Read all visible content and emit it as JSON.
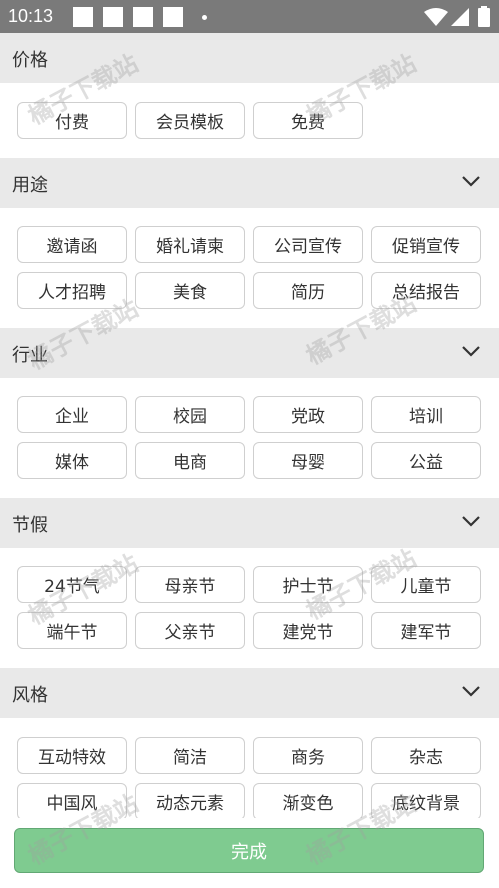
{
  "status_bar": {
    "time": "10:13"
  },
  "sections": {
    "price": {
      "title": "价格",
      "options": [
        "付费",
        "会员模板",
        "免费"
      ]
    },
    "usage": {
      "title": "用途",
      "options": [
        "邀请函",
        "婚礼请柬",
        "公司宣传",
        "促销宣传",
        "人才招聘",
        "美食",
        "简历",
        "总结报告"
      ]
    },
    "industry": {
      "title": "行业",
      "options": [
        "企业",
        "校园",
        "党政",
        "培训",
        "媒体",
        "电商",
        "母婴",
        "公益"
      ]
    },
    "holiday": {
      "title": "节假",
      "options": [
        "24节气",
        "母亲节",
        "护士节",
        "儿童节",
        "端午节",
        "父亲节",
        "建党节",
        "建军节"
      ]
    },
    "style": {
      "title": "风格",
      "options": [
        "互动特效",
        "简洁",
        "商务",
        "杂志",
        "中国风",
        "动态元素",
        "渐变色",
        "底纹背景"
      ]
    }
  },
  "done_button": {
    "label": "完成"
  },
  "watermark": "橘子下载站",
  "colors": {
    "status_bar": "#7a7a7a",
    "header_bg": "#e9e9e9",
    "done_bg": "#7fcb90"
  },
  "icons": {
    "expand": "chevron-down-icon"
  }
}
